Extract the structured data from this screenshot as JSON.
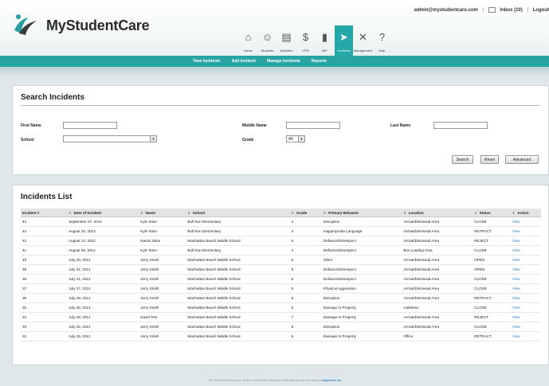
{
  "brand": {
    "name": "MyStudentCare"
  },
  "top_links": {
    "email": "admin@mystudentcare.com",
    "inbox": "Inbox (10)",
    "logout": "Logout",
    "sep": "|"
  },
  "nav": [
    {
      "label": "Home",
      "icon": "home-icon"
    },
    {
      "label": "Students",
      "icon": "students-icon"
    },
    {
      "label": "Activities",
      "icon": "activities-icon"
    },
    {
      "label": "CPR",
      "icon": "cpr-icon"
    },
    {
      "label": "BIP",
      "icon": "bip-icon"
    },
    {
      "label": "Incidents",
      "icon": "incidents-icon"
    },
    {
      "label": "Management",
      "icon": "management-icon"
    },
    {
      "label": "Help",
      "icon": "help-icon"
    }
  ],
  "subnav": [
    "View Incidents",
    "Add Incident",
    "Manage Incidents",
    "Reports"
  ],
  "search": {
    "title": "Search Incidents",
    "first_name_label": "First Name",
    "middle_name_label": "Middle Name",
    "last_name_label": "Last Name",
    "school_label": "School",
    "grade_label": "Grade",
    "grade_value": "All",
    "buttons": {
      "search": "Search",
      "reset": "Reset",
      "advanced": "Advanced"
    }
  },
  "list": {
    "title": "Incidents List",
    "columns": [
      "Incident #",
      "Date of Incident",
      "Name",
      "School",
      "Grade",
      "Primary Behavior",
      "Location",
      "Status",
      "Action"
    ],
    "rows": [
      [
        "44",
        "September 07, 2012",
        "Kyle Stine",
        "Bull Run Elementary",
        "4",
        "Disruption",
        "Arrival/Dismissal Area",
        "CLOSE",
        "View"
      ],
      [
        "43",
        "August 15, 2013",
        "Kyle Stine",
        "Bull Run Elementary",
        "4",
        "Inappropriate Language",
        "Arrival/Dismissal Area",
        "RETRACT",
        "View"
      ],
      [
        "42",
        "August 12, 2012",
        "Naomi Stine",
        "Manhattan Beach Middle School",
        "6",
        "Defiance/Disrespect",
        "Arrival/Dismissal Area",
        "REJECT",
        "View"
      ],
      [
        "41",
        "August 09, 2012",
        "Kyle Stine",
        "Bull Run Elementary",
        "4",
        "Defiance/Disrespect",
        "Bus Loading Area",
        "CLOSE",
        "View"
      ],
      [
        "40",
        "July 30, 2012",
        "Jerry Smith",
        "Manhattan Beach Middle School",
        "6",
        "Other",
        "Arrival/Dismissal Area",
        "OPEN",
        "View"
      ],
      [
        "39",
        "July 31, 2012",
        "Jerry Smith",
        "Manhattan Beach Middle School",
        "6",
        "Defiance/Disrespect",
        "Arrival/Dismissal Area",
        "OPEN",
        "View"
      ],
      [
        "38",
        "July 31, 2012",
        "Jerry Smith",
        "Manhattan Beach Middle School",
        "6",
        "Defiance/Disrespect",
        "Arrival/Dismissal Area",
        "CLOSE",
        "View"
      ],
      [
        "37",
        "July 27, 2012",
        "Jerry Smith",
        "Manhattan Beach Middle School",
        "6",
        "Physical Aggression",
        "Arrival/Dismissal Area",
        "CLOSE",
        "View"
      ],
      [
        "36",
        "July 28, 2012",
        "Jerry Smith",
        "Manhattan Beach Middle School",
        "6",
        "Disruption",
        "Arrival/Dismissal Area",
        "RETRACT",
        "View"
      ],
      [
        "35",
        "July 28, 2012",
        "Jerry Smith",
        "Manhattan Beach Middle School",
        "6",
        "Damage to Property",
        "Cafeteria",
        "CLOSE",
        "View"
      ],
      [
        "34",
        "July 28, 2012",
        "David Test",
        "Manhattan Beach Middle School",
        "7",
        "Damage to Property",
        "Arrival/Dismissal Area",
        "REJECT",
        "View"
      ],
      [
        "33",
        "July 28, 2012",
        "Jerry Smith",
        "Manhattan Beach Middle School",
        "6",
        "Disruption",
        "Arrival/Dismissal Area",
        "CLOSE",
        "View"
      ],
      [
        "32",
        "July 28, 2012",
        "Jerry Smith",
        "Manhattan Beach Middle School",
        "6",
        "Damage to Property",
        "Office",
        "RETRACT",
        "View"
      ]
    ]
  },
  "footer": {
    "text": "The MyStudentCare name, symbol, and service marks are trademarks and service marks of",
    "company": "Inspotech, Inc"
  },
  "colors": {
    "accent": "#28a4a4",
    "link": "#2a7fc9",
    "panel_bg": "#ffffff",
    "page_bg": "#dfe7ea"
  }
}
